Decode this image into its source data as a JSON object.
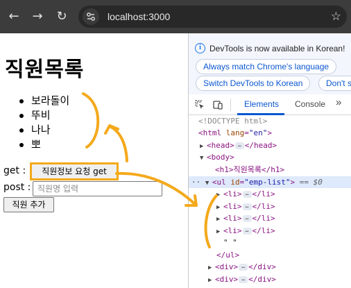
{
  "browser": {
    "url": "localhost:3000",
    "back_icon": "←",
    "forward_icon": "→",
    "reload_icon": "↻",
    "star_icon": "☆"
  },
  "page": {
    "title": "직원목록",
    "employees": [
      "보라돌이",
      "뚜비",
      "나나",
      "뽀"
    ],
    "get_label": "get :",
    "get_button": "직원정보 요청 get",
    "post_label": "post :",
    "post_placeholder": "직원명 입력",
    "add_button": "직원 추가"
  },
  "devtools": {
    "notice": "DevTools is now available in Korean!",
    "match_language_button": "Always match Chrome's language",
    "switch_korean_button": "Switch DevTools to Korean",
    "dont_show_button": "Don't s",
    "tabs": [
      "Elements",
      "Console"
    ],
    "more_tabs": "»",
    "dom": {
      "doctype": "<!DOCTYPE html>",
      "html_open": "<html",
      "html_attr": "lang",
      "html_val": "\"en\"",
      "html_close": ">",
      "head": "<head>",
      "head_end": "</head>",
      "body": "<body>",
      "h1": "<h1>직원목록</h1>",
      "ul_open": "<ul",
      "ul_attr": "id",
      "ul_val": "\"emp-list\"",
      "ul_close": ">",
      "selected_marker": "== $0",
      "li_open": "<li>",
      "li_close": "</li>",
      "text_node": "\" \"",
      "ul_end": "</ul>",
      "div_open": "<div>",
      "div_close": "</div>",
      "ellipsis": "…"
    }
  },
  "colors": {
    "annotation": "#f4a91b",
    "accent": "#0b57d0"
  }
}
